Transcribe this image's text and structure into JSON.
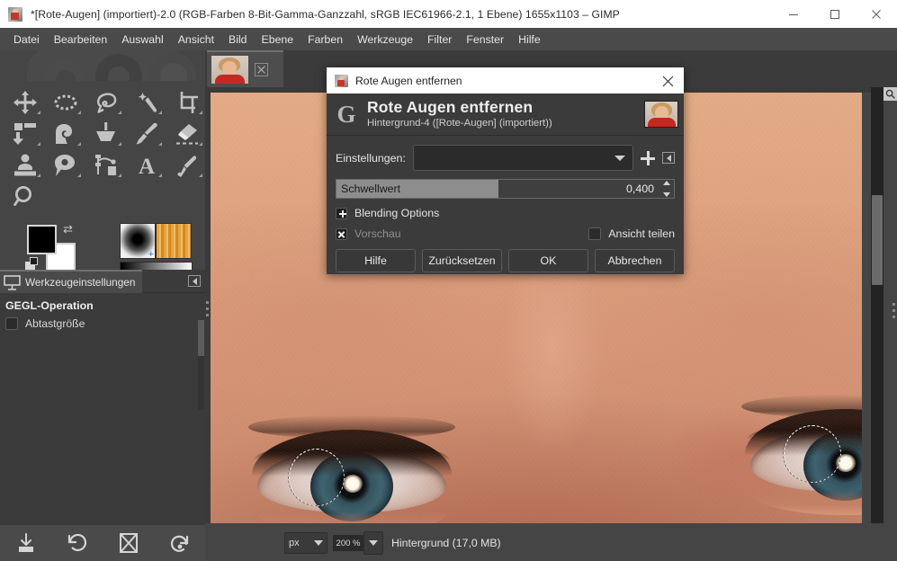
{
  "window": {
    "title": "*[Rote-Augen] (importiert)-2.0 (RGB-Farben 8-Bit-Gamma-Ganzzahl, sRGB IEC61966-2.1, 1 Ebene) 1655x1103 – GIMP",
    "icon": "gimp-image-icon",
    "controls": {
      "minimize": "minimize-icon",
      "maximize": "maximize-icon",
      "close": "close-icon"
    }
  },
  "menubar": {
    "items": [
      {
        "label": "Datei"
      },
      {
        "label": "Bearbeiten"
      },
      {
        "label": "Auswahl"
      },
      {
        "label": "Ansicht"
      },
      {
        "label": "Bild"
      },
      {
        "label": "Ebene"
      },
      {
        "label": "Farben"
      },
      {
        "label": "Werkzeuge"
      },
      {
        "label": "Filter"
      },
      {
        "label": "Fenster"
      },
      {
        "label": "Hilfe"
      }
    ]
  },
  "toolbox": {
    "tools": [
      {
        "name": "move-tool-icon"
      },
      {
        "name": "ellipse-select-tool-icon"
      },
      {
        "name": "free-select-tool-icon"
      },
      {
        "name": "fuzzy-select-tool-icon"
      },
      {
        "name": "crop-tool-icon"
      },
      {
        "name": "transform-tool-icon"
      },
      {
        "name": "warp-transform-tool-icon"
      },
      {
        "name": "bucket-fill-tool-icon"
      },
      {
        "name": "paintbrush-tool-icon"
      },
      {
        "name": "eraser-tool-icon"
      },
      {
        "name": "clone-tool-icon"
      },
      {
        "name": "smudge-tool-icon"
      },
      {
        "name": "paths-tool-icon"
      },
      {
        "name": "text-tool-icon"
      },
      {
        "name": "color-picker-tool-icon"
      },
      {
        "name": "zoom-tool-icon"
      }
    ],
    "colors": {
      "foreground": "#000000",
      "background": "#ffffff",
      "swap_icon": "swap-colors-icon",
      "reset_icon": "reset-colors-icon"
    },
    "brush_swatch": "brush-swatch-icon",
    "pattern_swatch": "pattern-swatch-icon",
    "gradient_swatch": "gradient-swatch-icon"
  },
  "dock": {
    "tab_label": "Werkzeugeinstellungen",
    "tab_icon": "tool-options-icon",
    "menu_icon": "dock-menu-icon",
    "section_title": "GEGL-Operation",
    "option_label": "Abtastgröße"
  },
  "bottom_toolbar": {
    "buttons": [
      {
        "name": "save-tool-preset-icon"
      },
      {
        "name": "restore-tool-preset-icon"
      },
      {
        "name": "delete-tool-preset-icon"
      },
      {
        "name": "reset-tool-options-icon"
      }
    ]
  },
  "image_window": {
    "tab": {
      "title": "Rote-Augen-thumbnail",
      "close_icon": "close-tab-icon"
    },
    "navigation_icon": "navigate-image-icon",
    "quickmask_icon": "quick-mask-toggle-icon",
    "zoom_image_icon": "zoom-image-window-icon",
    "statusbar": {
      "unit": "px",
      "zoom": "200 %",
      "text": "Hintergrund (17,0 MB)"
    }
  },
  "dialog": {
    "titlebar": {
      "title": "Rote Augen entfernen",
      "icon": "gimp-image-icon",
      "close_icon": "close-icon"
    },
    "header": {
      "logo": "gimp-g-logo",
      "title": "Rote Augen entfernen",
      "subtitle": "Hintergrund-4 ([Rote-Augen] (importiert))",
      "thumbnail": "layer-thumbnail"
    },
    "settings": {
      "label": "Einstellungen:",
      "value": "",
      "dropdown_icon": "chevron-down-icon",
      "add_icon": "add-preset-icon",
      "menu_icon": "preset-menu-icon"
    },
    "threshold": {
      "label": "Schwellwert",
      "value": "0,400",
      "fill_percent": 48,
      "spinner_icon": "spinner-arrows-icon"
    },
    "blending": {
      "label": "Blending Options",
      "expander_icon": "expander-plus-icon",
      "expanded": false
    },
    "preview": {
      "label": "Vorschau",
      "checked": true,
      "checkbox_icon": "checkbox-checked-icon"
    },
    "split_view": {
      "label": "Ansicht teilen",
      "checked": false,
      "checkbox_icon": "checkbox-unchecked-icon"
    },
    "buttons": [
      {
        "label": "Hilfe",
        "name": "help-button"
      },
      {
        "label": "Zurücksetzen",
        "name": "reset-button"
      },
      {
        "label": "OK",
        "name": "ok-button"
      },
      {
        "label": "Abbrechen",
        "name": "cancel-button"
      }
    ]
  },
  "colors": {
    "titlebar_bg": "#ffffff",
    "menubar_bg": "#4a4a4a",
    "panel_bg": "#454545",
    "dock_bg": "#3b3b3b",
    "dialog_bg": "#3b3b3b",
    "text": "#e6e6e6"
  }
}
